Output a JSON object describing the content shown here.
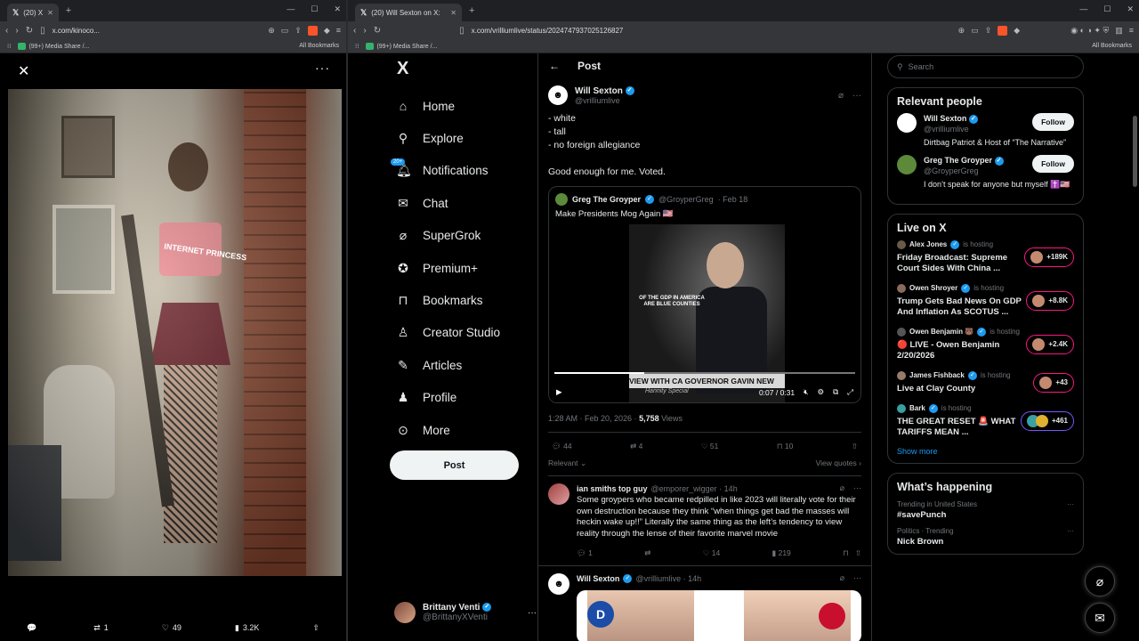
{
  "left_window": {
    "tab_title": "(20) X",
    "url": "x.com/kinoco...",
    "bookmark": "(99+) Media Share /...",
    "all_bookmarks": "All Bookmarks",
    "photo_text": "INTERNET PRINCESS",
    "bar": {
      "replies": "",
      "reposts": "1",
      "likes": "49",
      "views": "3.2K"
    }
  },
  "right_window": {
    "tab_title": "(20) Will Sexton on X: \"- white -",
    "url": "x.com/vrilliumlive/status/2024747937025126827",
    "bookmark": "(99+) Media Share /...",
    "all_bookmarks": "All Bookmarks"
  },
  "nav": {
    "logo": "X",
    "items": [
      {
        "label": "Home",
        "icon": "home-icon"
      },
      {
        "label": "Explore",
        "icon": "search-icon"
      },
      {
        "label": "Notifications",
        "icon": "bell-icon",
        "badge": "20+"
      },
      {
        "label": "Chat",
        "icon": "mail-icon"
      },
      {
        "label": "SuperGrok",
        "icon": "grok-icon"
      },
      {
        "label": "Premium+",
        "icon": "premium-icon"
      },
      {
        "label": "Bookmarks",
        "icon": "bookmark-icon"
      },
      {
        "label": "Creator Studio",
        "icon": "creator-icon"
      },
      {
        "label": "Articles",
        "icon": "article-icon"
      },
      {
        "label": "Profile",
        "icon": "person-icon"
      },
      {
        "label": "More",
        "icon": "more-icon"
      }
    ],
    "post_button": "Post",
    "account": {
      "name": "Brittany Venti",
      "handle": "@BrittanyXVenti"
    }
  },
  "main": {
    "header": "Post",
    "tweet": {
      "name": "Will Sexton",
      "handle": "@vrilliumlive",
      "text": "- white\n- tall\n- no foreign allegiance\n\nGood enough for me. Voted.",
      "quote": {
        "name": "Greg The Groyper",
        "handle": "@GroyperGreg",
        "date": "· Feb 18",
        "text": "Make Presidents Mog Again 🇺🇸",
        "video_caption": "OF THE GDP IN AMERICA ARE BLUE COUNTIES",
        "lower_third": "VIEW WITH CA GOVERNOR GAVIN NEW",
        "lower_third2": "Hannity Special",
        "time": "0:07 / 0:31",
        "progress": 0.3
      },
      "timestamp": "1:28 AM · Feb 20, 2026 · ",
      "views": "5,758",
      "views_label": " Views",
      "replies": "44",
      "reposts": "4",
      "likes": "51",
      "bookmarks": "10",
      "sort": "Relevant",
      "view_quotes": "View quotes"
    },
    "replies": [
      {
        "name": "ian smiths top guy",
        "handle": "@emporer_wigger · 14h",
        "text": "Some groypers who became redpilled in like 2023 will literally vote for their own destruction because they think “when things get bad the masses will heckin wake up!!” Literally the same thing as the left’s tendency to view reality through the lense of their favorite marvel movie",
        "replies": "1",
        "reposts": "",
        "likes": "14",
        "views": "219"
      },
      {
        "name": "Will Sexton",
        "handle": "@vrilliumlive · 14h",
        "image_letter": "D"
      }
    ]
  },
  "sidebar": {
    "search_placeholder": "Search",
    "relevant_title": "Relevant people",
    "people": [
      {
        "name": "Will Sexton",
        "handle": "@vrilliumlive",
        "bio": "Dirtbag Patriot & Host of “The Narrative”",
        "follow": "Follow"
      },
      {
        "name": "Greg The Groyper",
        "handle": "@GroyperGreg",
        "bio": "I don’t speak for anyone but myself ✝️🇺🇸",
        "follow": "Follow"
      }
    ],
    "live_title": "Live on X",
    "live": [
      {
        "host": "Alex Jones",
        "hosting": "is hosting",
        "title": "Friday Broadcast: Supreme Court Sides With China ...",
        "count": "+189K"
      },
      {
        "host": "Owen Shroyer",
        "hosting": "is hosting",
        "title": "Trump Gets Bad News On GDP And Inflation As SCOTUS ...",
        "count": "+8.8K"
      },
      {
        "host": "Owen Benjamin 🐻",
        "hosting": "is hosting",
        "title": "🔴 LIVE - Owen Benjamin 2/20/2026",
        "count": "+2.4K"
      },
      {
        "host": "James Fishback",
        "hosting": "is hosting",
        "title": "Live at Clay County",
        "count": "+43"
      },
      {
        "host": "Bark",
        "hosting": "is hosting",
        "title": "THE GREAT RESET 🚨 WHAT TARIFFS MEAN ...",
        "count": "+461"
      }
    ],
    "show_more": "Show more",
    "happening_title": "What’s happening",
    "trends": [
      {
        "context": "Trending in United States",
        "topic": "#savePunch"
      },
      {
        "context": "Politics · Trending",
        "topic": "Nick Brown"
      }
    ]
  },
  "colors": {
    "accent": "#1d9bf0",
    "live_border": "#f91880",
    "background": "#000000"
  }
}
